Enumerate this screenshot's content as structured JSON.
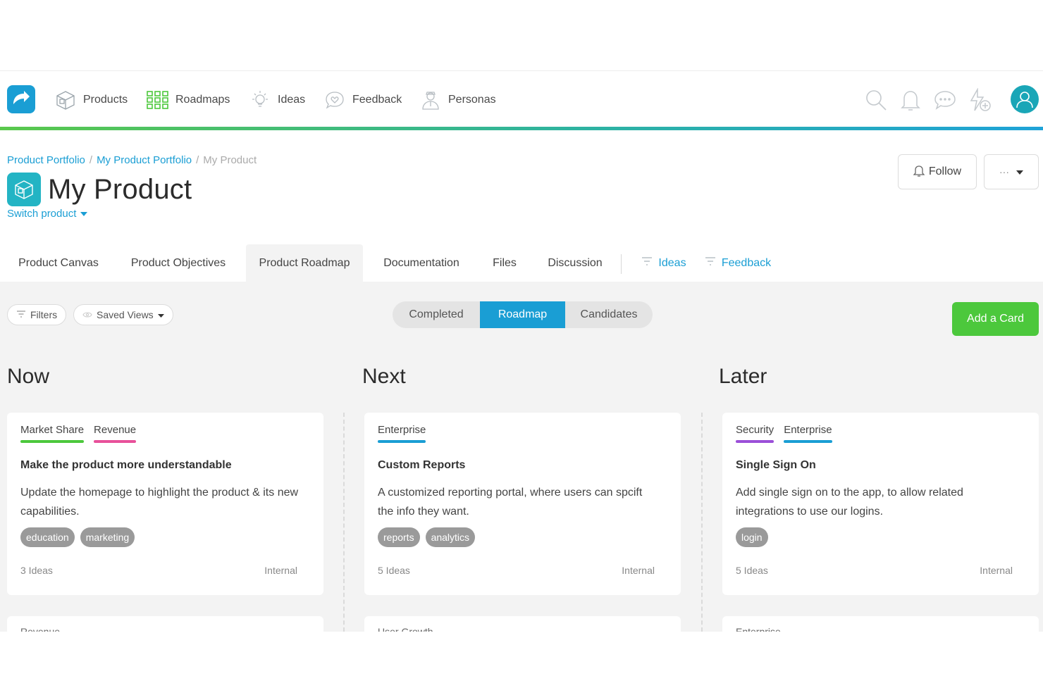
{
  "nav": {
    "items": [
      {
        "label": "Products",
        "icon": "box-icon"
      },
      {
        "label": "Roadmaps",
        "icon": "grid-icon"
      },
      {
        "label": "Ideas",
        "icon": "lightbulb-icon"
      },
      {
        "label": "Feedback",
        "icon": "chat-heart-icon"
      },
      {
        "label": "Personas",
        "icon": "person-icon"
      }
    ],
    "right_icons": [
      "search-icon",
      "bell-icon",
      "chat-icon",
      "lightning-plus-icon",
      "user-avatar-icon"
    ],
    "accent_gradient": [
      "#5ac84c",
      "#1fa3d8"
    ]
  },
  "breadcrumb": {
    "items": [
      "Product Portfolio",
      "My Product Portfolio"
    ],
    "current": "My Product",
    "separator": "/"
  },
  "header": {
    "title": "My Product",
    "switch_label": "Switch product",
    "follow_label": "Follow",
    "more_label": "···"
  },
  "tabs": {
    "items": [
      "Product Canvas",
      "Product Objectives",
      "Product Roadmap",
      "Documentation",
      "Files",
      "Discussion"
    ],
    "active": "Product Roadmap",
    "filter_links": [
      "Ideas",
      "Feedback"
    ]
  },
  "toolbar": {
    "filters_label": "Filters",
    "saved_views_label": "Saved Views",
    "segments": [
      "Completed",
      "Roadmap",
      "Candidates"
    ],
    "active_segment": "Roadmap",
    "add_card_label": "Add a Card"
  },
  "colors": {
    "primary": "#1a9ed4",
    "success": "#4cc83c",
    "market_share": "#4cc83c",
    "revenue": "#e8509a",
    "enterprise": "#1a9ed4",
    "security": "#9b4fd8"
  },
  "columns": [
    {
      "title": "Now",
      "card": {
        "categories": [
          {
            "name": "Market Share",
            "color": "#4cc83c"
          },
          {
            "name": "Revenue",
            "color": "#e8509a"
          }
        ],
        "title": "Make the product more understandable",
        "description": "Update the homepage to highlight the product & its new capabilities.",
        "tags": [
          "education",
          "marketing"
        ],
        "ideas": "3 Ideas",
        "visibility": "Internal"
      },
      "next_card_label": "Revenue"
    },
    {
      "title": "Next",
      "card": {
        "categories": [
          {
            "name": "Enterprise",
            "color": "#1a9ed4"
          }
        ],
        "title": "Custom Reports",
        "description": "A customized reporting portal, where users can spcift the info they want.",
        "tags": [
          "reports",
          "analytics"
        ],
        "ideas": "5 Ideas",
        "visibility": "Internal"
      },
      "next_card_label": "User Growth"
    },
    {
      "title": "Later",
      "card": {
        "categories": [
          {
            "name": "Security",
            "color": "#9b4fd8"
          },
          {
            "name": "Enterprise",
            "color": "#1a9ed4"
          }
        ],
        "title": "Single Sign On",
        "description": "Add single sign on to the app, to allow related integrations to use our logins.",
        "tags": [
          "login"
        ],
        "ideas": "5 Ideas",
        "visibility": "Internal"
      },
      "next_card_label": "Enterprise"
    }
  ]
}
